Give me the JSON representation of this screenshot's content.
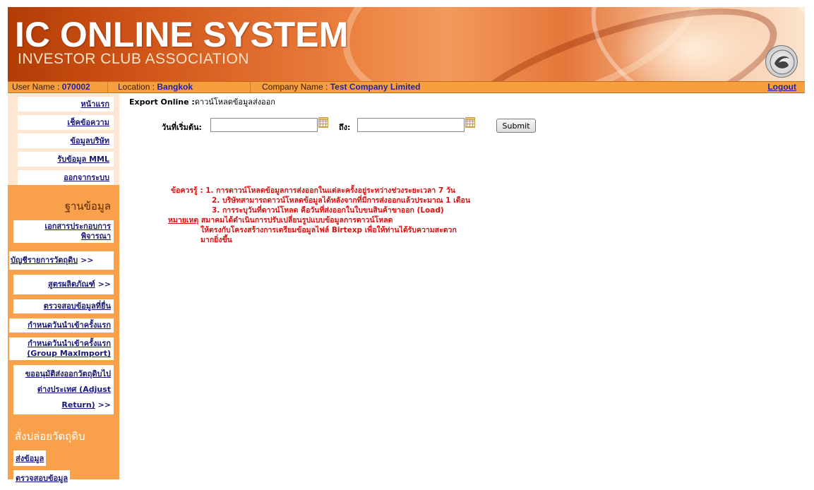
{
  "header": {
    "title": "IC ONLINE SYSTEM",
    "subtitle": "INVESTOR CLUB ASSOCIATION",
    "logo_icon": "boi-seal-icon"
  },
  "infobar": {
    "user_label": "User Name : ",
    "user_value": "070002",
    "location_label": "Location : ",
    "location_value": "Bangkok",
    "company_label": "Company Name : ",
    "company_value": "Test Company Limited",
    "logout": "Logout"
  },
  "sidebar": {
    "top_menu": [
      "หน้าแรก",
      "เช็คข้อความ",
      "ข้อมูลบริษัท",
      "รับข้อมูล MML",
      "ออกจากระบบ"
    ],
    "section1_title": "ฐานข้อมูล",
    "section1_items": [
      "เอกสารประกอบการพิจารณา",
      "บัญชีรายการวัตถุดิบ",
      "สูตรผลิตภัณฑ์",
      "ตรวจสอบข้อมูลที่ยื่น",
      "กำหนดวันนำเข้าครั้งแรก",
      "กำหนดวันนำเข้าครั้งแรก (Group MaxImport)",
      "ขออนุมัติส่งออกวัตถุดิบไปต่างประเทศ (Adjust Return)"
    ],
    "arrow": ">>",
    "section2_title": "สั่งปล่อยวัตถุดิบ",
    "section2_items": [
      "ส่งข้อมูล",
      "ตรวจสอบข้อมูล"
    ]
  },
  "main": {
    "title_bold": "Export Online :",
    "title_text": "ดาวน์โหลดข้อมูลส่งออก",
    "start_label": "วันที่เริ่มต้น:",
    "start_value": "",
    "to_label": "ถึง:",
    "end_value": "",
    "submit_label": "Submit",
    "note_label": "ข้อควรรู้ :",
    "notes": [
      "1. การดาวน์โหลดข้อมูลการส่งออกในแต่ละครั้งอยู่ระหว่างช่วงระยะเวลา 7 วัน",
      "2. บริษัทสามารถดาวน์โหลดข้อมูลได้หลังจากที่มีการส่งออกแล้วประมาณ 1 เดือน",
      "3. การระบุวันที่ดาวน์โหลด คือวันที่ส่งออกในใบขนสินค้าขาออก (Load)"
    ],
    "remark_label": "หมายเหตุ",
    "remark_lines": [
      "สมาคมได้ดำเนินการปรับเปลี่ยนรูปแบบข้อมูลการดาวน์โหลด",
      "ให้ตรงกับโครงสร้างการเตรียมข้อมูลไฟล์ Birtexp เพื่อให้ท่านได้รับความสะดวก",
      "มากยิ่งขึ้น"
    ]
  },
  "colors": {
    "banner": "#e5773a",
    "infobar": "#f59f3e",
    "sidebar": "#f9a04a",
    "notice": "#e01010",
    "link": "#1a1a7a"
  }
}
